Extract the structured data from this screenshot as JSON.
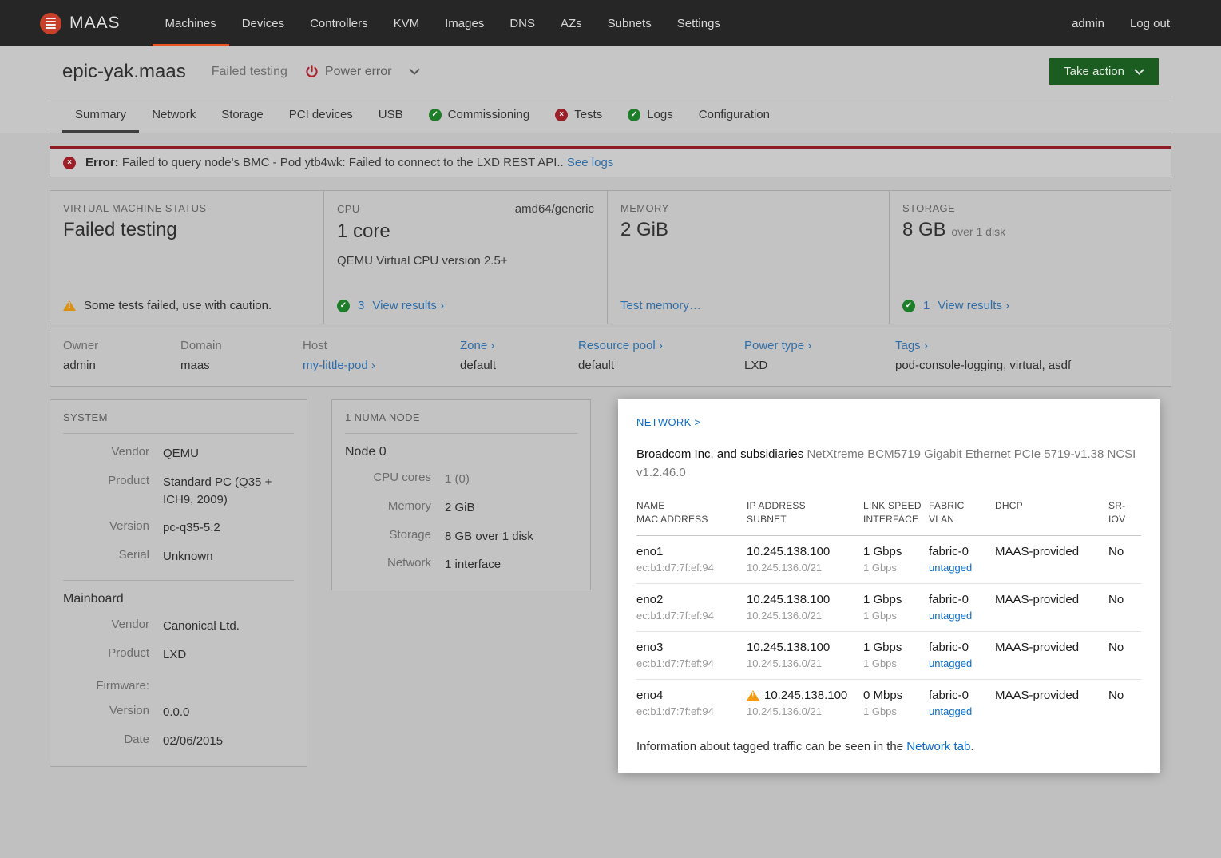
{
  "nav": {
    "brand": "MAAS",
    "items": [
      "Machines",
      "Devices",
      "Controllers",
      "KVM",
      "Images",
      "DNS",
      "AZs",
      "Subnets",
      "Settings"
    ],
    "admin": "admin",
    "logout": "Log out"
  },
  "header": {
    "title": "epic-yak.maas",
    "status": "Failed testing",
    "power_label": "Power error",
    "take_action_label": "Take action"
  },
  "tabs": [
    {
      "label": "Summary"
    },
    {
      "label": "Network"
    },
    {
      "label": "Storage"
    },
    {
      "label": "PCI devices"
    },
    {
      "label": "USB"
    },
    {
      "label": "Commissioning"
    },
    {
      "label": "Tests"
    },
    {
      "label": "Logs"
    },
    {
      "label": "Configuration"
    }
  ],
  "icons": {
    "check": "✓",
    "cross": "×"
  },
  "error_banner": {
    "prefix": "Error:",
    "message": "Failed to query node's BMC - Pod ytb4wk: Failed to connect to the LXD REST API..",
    "link": "See logs"
  },
  "overview": {
    "status": {
      "label": "VIRTUAL MACHINE STATUS",
      "value": "Failed testing",
      "note": "Some tests failed, use with caution."
    },
    "cpu": {
      "label": "CPU",
      "arch": "amd64/generic",
      "value": "1 core",
      "detail": "QEMU Virtual CPU version 2.5+",
      "count": "3",
      "link": "View results ›"
    },
    "memory": {
      "label": "MEMORY",
      "value": "2 GiB",
      "link": "Test memory…"
    },
    "storage": {
      "label": "STORAGE",
      "value": "8 GB",
      "suffix": "over 1 disk",
      "count": "1",
      "link": "View results ›"
    }
  },
  "meta": {
    "owner": {
      "label": "Owner",
      "value": "admin"
    },
    "domain": {
      "label": "Domain",
      "value": "maas"
    },
    "host": {
      "label": "Host",
      "value": "my-little-pod ›"
    },
    "zone": {
      "label": "Zone ›",
      "value": "default"
    },
    "pool": {
      "label": "Resource pool ›",
      "value": "default"
    },
    "power": {
      "label": "Power type ›",
      "value": "LXD"
    },
    "tags": {
      "label": "Tags ›",
      "value": "pod-console-logging, virtual, asdf"
    }
  },
  "system": {
    "title": "SYSTEM",
    "vendor_label": "Vendor",
    "vendor": "QEMU",
    "product_label": "Product",
    "product": "Standard PC (Q35 + ICH9, 2009)",
    "version_label": "Version",
    "version": "pc-q35-5.2",
    "serial_label": "Serial",
    "serial": "Unknown",
    "mainboard_title": "Mainboard",
    "mb_vendor_label": "Vendor",
    "mb_vendor": "Canonical Ltd.",
    "mb_product_label": "Product",
    "mb_product": "LXD",
    "firmware_label": "Firmware:",
    "fw_version_label": "Version",
    "fw_version": "0.0.0",
    "fw_date_label": "Date",
    "fw_date": "02/06/2015"
  },
  "numa": {
    "title": "1 NUMA NODE",
    "node": "Node 0",
    "cores_label": "CPU cores",
    "cores": "1 (0)",
    "memory_label": "Memory",
    "memory": "2 GiB",
    "storage_label": "Storage",
    "storage": "8 GB over 1 disk",
    "network_label": "Network",
    "network": "1 interface"
  },
  "network": {
    "link": "NETWORK >",
    "card_title": "Broadcom Inc. and subsidiaries",
    "card_subtitle": " NetXtreme BCM5719 Gigabit Ethernet PCIe 5719-v1.38 NCSI v1.2.46.0",
    "headers": {
      "name1": "NAME",
      "name2": "MAC ADDRESS",
      "ip1": "IP ADDRESS",
      "ip2": "SUBNET",
      "speed1": "LINK SPEED",
      "speed2": "INTERFACE",
      "fabric1": "FABRIC",
      "fabric2": "VLAN",
      "dhcp": "DHCP",
      "sriov": "SR-IOV"
    },
    "rows": [
      {
        "name": "eno1",
        "mac": "ec:b1:d7:7f:ef:94",
        "ip": "10.245.138.100",
        "subnet": "10.245.136.0/21",
        "speed": "1 Gbps",
        "iface": "1 Gbps",
        "fabric": "fabric-0",
        "vlan": "untagged",
        "dhcp": "MAAS-provided",
        "sriov": "No"
      },
      {
        "name": "eno2",
        "mac": "ec:b1:d7:7f:ef:94",
        "ip": "10.245.138.100",
        "subnet": "10.245.136.0/21",
        "speed": "1 Gbps",
        "iface": "1 Gbps",
        "fabric": "fabric-0",
        "vlan": "untagged",
        "dhcp": "MAAS-provided",
        "sriov": "No"
      },
      {
        "name": "eno3",
        "mac": "ec:b1:d7:7f:ef:94",
        "ip": "10.245.138.100",
        "subnet": "10.245.136.0/21",
        "speed": "1 Gbps",
        "iface": "1 Gbps",
        "fabric": "fabric-0",
        "vlan": "untagged",
        "dhcp": "MAAS-provided",
        "sriov": "No"
      },
      {
        "name": "eno4",
        "mac": "ec:b1:d7:7f:ef:94",
        "ip": "10.245.138.100",
        "subnet": "10.245.136.0/21",
        "speed": "0 Mbps",
        "iface": "1 Gbps",
        "fabric": "fabric-0",
        "vlan": "untagged",
        "dhcp": "MAAS-provided",
        "sriov": "No"
      }
    ],
    "footer_text": "Information about tagged traffic can be seen in the ",
    "footer_link": "Network tab",
    "footer_end": "."
  }
}
